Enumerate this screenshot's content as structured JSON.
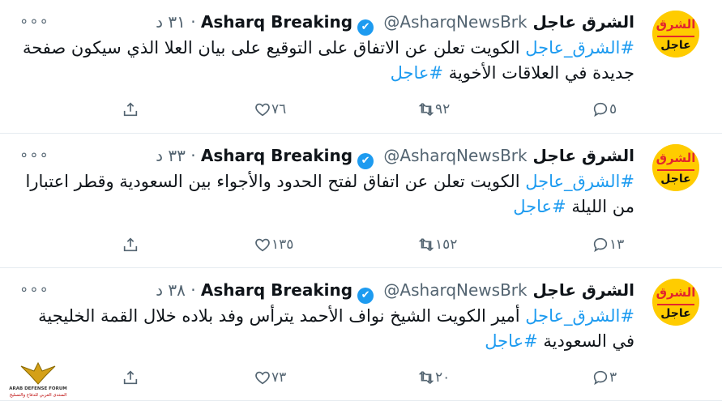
{
  "tweets": [
    {
      "avatar": {
        "top": "الشرق",
        "bottom": "عاجل"
      },
      "name": "الشرق عاجل Asharq Breaking",
      "handle": "@AsharqNewsBrk",
      "dot": "·",
      "time": "٣١ د",
      "hashtag": "#الشرق_عاجل",
      "text": " الكويت تعلن عن الاتفاق على التوقيع على بيان العلا الذي سيكون صفحة جديدة في العلاقات الأخوية ",
      "hashtag2": "#عاجل",
      "replies": "٥",
      "retweets": "٩٢",
      "likes": "٧٦"
    },
    {
      "avatar": {
        "top": "الشرق",
        "bottom": "عاجل"
      },
      "name": "الشرق عاجل Asharq Breaking",
      "handle": "@AsharqNewsBrk",
      "dot": "·",
      "time": "٣٣ د",
      "hashtag": "#الشرق_عاجل",
      "text": " الكويت تعلن عن اتفاق لفتح الحدود والأجواء بين السعودية وقطر اعتبارا من الليلة ",
      "hashtag2": "#عاجل",
      "replies": "١٣",
      "retweets": "١٥٢",
      "likes": "١٣٥"
    },
    {
      "avatar": {
        "top": "الشرق",
        "bottom": "عاجل"
      },
      "name": "الشرق عاجل Asharq Breaking",
      "handle": "@AsharqNewsBrk",
      "dot": "·",
      "time": "٣٨ د",
      "hashtag": "#الشرق_عاجل",
      "text": " أمير الكويت الشيخ نواف الأحمد يترأس وفد بلاده خلال القمة الخليجية في السعودية ",
      "hashtag2": "#عاجل",
      "replies": "٣",
      "retweets": "٢٠",
      "likes": "٧٣"
    }
  ],
  "more_glyph": "∘∘∘",
  "verified_glyph": "✔",
  "watermark": {
    "line1": "ARAB DEFENSE FORUM",
    "line2": "المنتدى العربي للدفاع والتسليح"
  },
  "colors": {
    "link": "#1d9bf0",
    "muted": "#536471",
    "avatar_bg": "#ffcc00",
    "avatar_red": "#e3262d"
  }
}
